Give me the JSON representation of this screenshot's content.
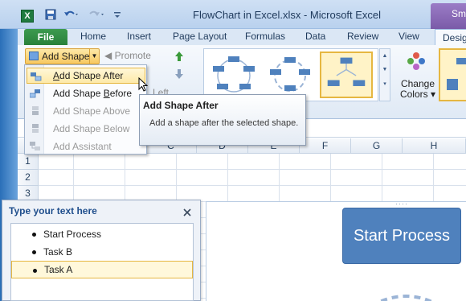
{
  "window": {
    "title": "FlowChart in Excel.xlsx  -  Microsoft Excel",
    "app_icon": "X",
    "context_tab": "Sma"
  },
  "tabs": [
    {
      "label": "File"
    },
    {
      "label": "Home"
    },
    {
      "label": "Insert"
    },
    {
      "label": "Page Layout"
    },
    {
      "label": "Formulas"
    },
    {
      "label": "Data"
    },
    {
      "label": "Review"
    },
    {
      "label": "View"
    },
    {
      "label": "Desig"
    }
  ],
  "ribbon": {
    "add_shape": "Add Shape",
    "promote": "Promote",
    "left": "Left",
    "change_colors_line1": "Change",
    "change_colors_line2": "Colors",
    "group_label": "ts"
  },
  "menu": {
    "items": [
      {
        "label": "Add Shape After",
        "enabled": true,
        "hover": true,
        "icon": "add-after-icon"
      },
      {
        "label": "Add Shape Before",
        "enabled": true,
        "hover": false,
        "icon": "add-before-icon"
      },
      {
        "label": "Add Shape Above",
        "enabled": false,
        "hover": false,
        "icon": "add-above-icon"
      },
      {
        "label": "Add Shape Below",
        "enabled": false,
        "hover": false,
        "icon": "add-below-icon"
      },
      {
        "label": "Add Assistant",
        "enabled": false,
        "hover": false,
        "icon": "add-assistant-icon"
      }
    ]
  },
  "tooltip": {
    "title": "Add Shape After",
    "body": "Add a shape after the selected shape."
  },
  "sheet": {
    "columns": [
      "C",
      "D",
      "E",
      "F",
      "G",
      "H"
    ],
    "rows": [
      "1",
      "2",
      "3"
    ]
  },
  "text_pane": {
    "title": "Type your text here",
    "items": [
      {
        "text": "Start Process",
        "selected": false
      },
      {
        "text": "Task B",
        "selected": false
      },
      {
        "text": "Task A",
        "selected": true
      }
    ]
  },
  "smartart": {
    "start_shape": "Start Process",
    "shape_color": "#4f81bd"
  },
  "colors": {
    "file_tab": "#27803a",
    "highlight": "#fde9a8",
    "accent_blue": "#1f4e8c"
  }
}
